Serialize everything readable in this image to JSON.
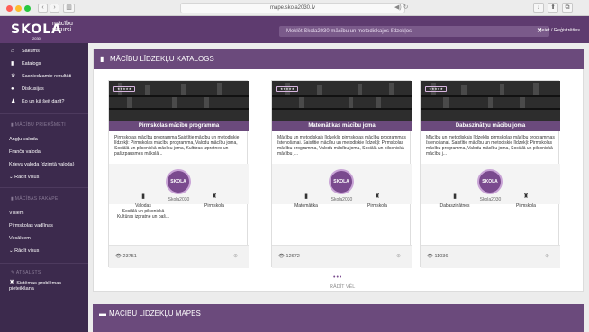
{
  "browser": {
    "url": "mape.skola2030.lv",
    "back": "‹",
    "forward": "›",
    "sidebar_toggle": "▥",
    "reload": "◀) ↻",
    "share": "⬆",
    "tabs": "⧉",
    "download": "↓"
  },
  "header": {
    "logo": "SKOLA",
    "logo_sub_1": "mācību",
    "logo_sub_2": "resursi",
    "year": "2030",
    "search_placeholder": "Meklēt Skola2030 mācību un metodiskajos līdzekļos",
    "search_clear": "✕",
    "login": "Ieiet / Reģistrēties"
  },
  "sidebar": {
    "items": [
      {
        "icon": "home-icon",
        "glyph": "⌂",
        "label": "Sākums"
      },
      {
        "icon": "book-icon",
        "glyph": "▮",
        "label": "Katalogs"
      },
      {
        "icon": "trophy-icon",
        "glyph": "♛",
        "label": "Sasniedzamie rezultāti"
      },
      {
        "icon": "chat-icon",
        "glyph": "●",
        "label": "Diskusijas"
      },
      {
        "icon": "people-icon",
        "glyph": "♟",
        "label": "Ko un kā šeit darīt?"
      }
    ],
    "subjects_head": "MĀCĪBU PRIEKŠMETI",
    "subjects": [
      "Angļu valoda",
      "Franču valoda",
      "Krievu valoda (dzimtā valoda)"
    ],
    "subjects_more": "Rādīt visus",
    "school_head": "MĀCĪBAS PAKĀPE",
    "school": [
      "Visiem",
      "Pirmskolas vadlīnas",
      "Vecākiem"
    ],
    "school_more": "Rādīt visus",
    "help_head": "ATBALSTS",
    "help_item": "Sistēmas problēmas pieteikšana"
  },
  "main": {
    "catalog_title": "MĀCĪBU LĪDZEKĻU KATALOGS",
    "maps_title": "MĀCĪBU LĪDZEKĻU MAPES",
    "more_dots": "•••",
    "more": "RĀDĪT VĒL",
    "cards": [
      {
        "title": "Pirmskolas mācību programma",
        "desc": "Pirmskolas mācību programma Saistītie mācību un metodiskie līdzekļi: Pirmskolas mācību programma, Valodu mācību joma, Sociālā un pilsoniskā mācību joma, Kultūras izpratnes un pašizpausmes mākslā...",
        "author": "Skola2030",
        "area": "Valodas\nSociālā un pilsoniskā\nKultūras izpratne un paš...",
        "level": "Pirmskola",
        "views": "23751"
      },
      {
        "title": "Matemātikas mācību joma",
        "desc": "Mācību un metodiskais līdzeklis pirmskolas mācību programmas īstenošanai. Saistītie mācību un metodiskie līdzekļi: Pirmskolas mācību programma, Valodu mācību joma, Sociālā un pilsoniskā mācību j...",
        "author": "Skola2030",
        "area": "Matemātika",
        "level": "Pirmskola",
        "views": "12672"
      },
      {
        "title": "Dabaszinātņu mācību joma",
        "desc": "Mācību un metodiskais līdzeklis pirmskolas mācību programmas īstenošanai. Saistītie mācību un metodiskie līdzekļi: Pirmskolas mācību programma, Valodu mācību joma, Sociālā un pilsoniskā mācību j...",
        "author": "Skola2030",
        "area": "Dabaszinātnes",
        "level": "Pirmskola",
        "views": "11036"
      }
    ]
  },
  "colors": {
    "brand": "#5e3b6f",
    "sidebar": "#3c2a4d",
    "panel_head": "#6b4a7c"
  }
}
